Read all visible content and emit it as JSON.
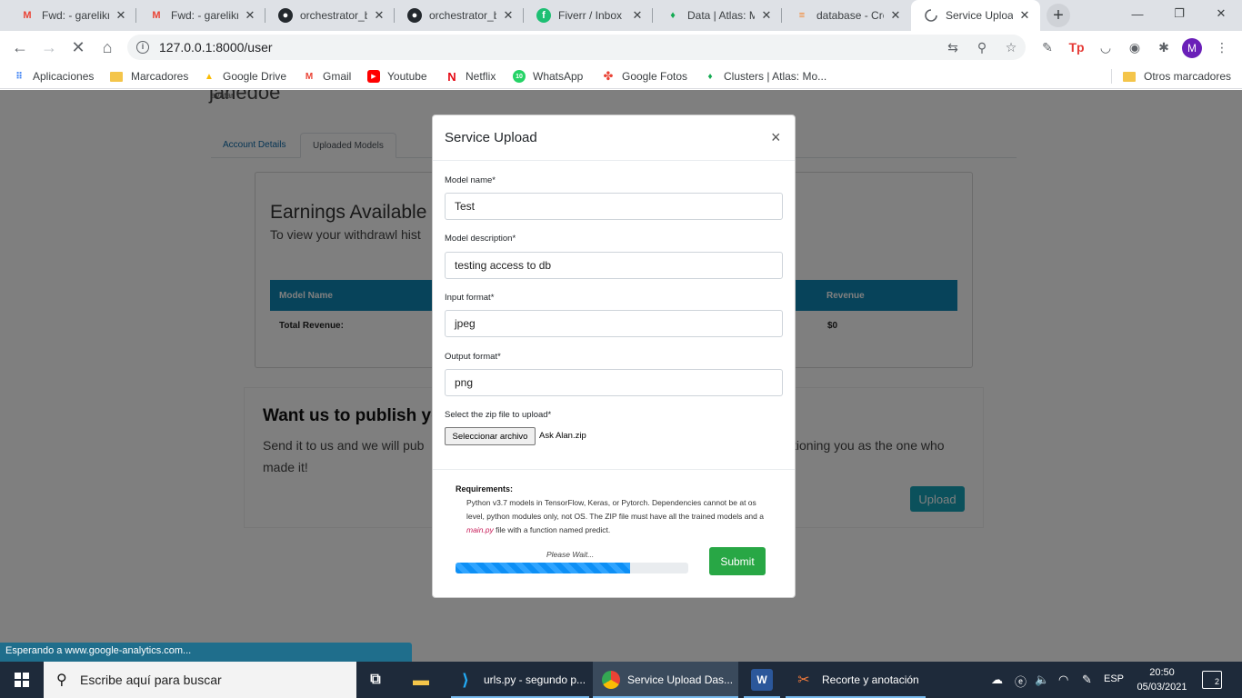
{
  "browser": {
    "tabs": [
      {
        "title": "Fwd: - garelikm",
        "icon": "gmail-icon",
        "active": false
      },
      {
        "title": "Fwd: - garelikm",
        "icon": "gmail-icon",
        "active": false
      },
      {
        "title": "orchestrator_b",
        "icon": "github-icon",
        "active": false
      },
      {
        "title": "orchestrator_b",
        "icon": "github-icon",
        "active": false
      },
      {
        "title": "Fiverr / Inbox",
        "icon": "fiverr-icon",
        "active": false
      },
      {
        "title": "Data | Atlas: M",
        "icon": "mongodb-icon",
        "active": false
      },
      {
        "title": "database - Cre",
        "icon": "stackoverflow-icon",
        "active": false
      },
      {
        "title": "Service Upload",
        "icon": "loading-icon",
        "active": true
      }
    ],
    "url": "127.0.0.1:8000/user",
    "profile_initial": "M",
    "bookmarks": [
      "Aplicaciones",
      "Marcadores",
      "Google Drive",
      "Gmail",
      "Youtube",
      "Netflix",
      "WhatsApp",
      "Google Fotos",
      "Clusters | Atlas: Mo...",
      "Otros marcadores"
    ],
    "status_text": "Esperando a www.google-analytics.com..."
  },
  "page": {
    "username": "janedoe",
    "avatar_alt": "avatar",
    "tabs": [
      "Account Details",
      "Uploaded Models"
    ],
    "earnings_title": "Earnings Available f",
    "earnings_sub": "To view your withdrawl hist",
    "table_headers": [
      "Model Name",
      "Revenue"
    ],
    "total_label": "Total Revenue:",
    "total_value": "$0",
    "publish_title": "Want us to publish yo",
    "publish_text_a": "Send it to us and we will pub",
    "publish_text_b": "tioning you as the one who",
    "publish_text_c": "made it!",
    "upload_button": "Upload"
  },
  "modal": {
    "title": "Service Upload",
    "close_glyph": "×",
    "fields": [
      {
        "label": "Model name*",
        "value": "Test"
      },
      {
        "label": "Model description*",
        "value": "testing access to db"
      },
      {
        "label": "Input format*",
        "value": "jpeg"
      },
      {
        "label": "Output format*",
        "value": "png"
      }
    ],
    "file_label": "Select the zip file to upload*",
    "file_button": "Seleccionar archivo",
    "file_name": "Ask Alan.zip",
    "requirements_title": "Requirements:",
    "requirements_a": "Python v3.7 models in TensorFlow, Keras, or Pytorch. Dependencies cannot be at os level, python modules only, not OS. The ZIP file must have all the trained models and a ",
    "requirements_file": "main.py",
    "requirements_b": " file with a function named predict.",
    "wait_text": "Please Wait...",
    "progress": 0.75,
    "submit": "Submit"
  },
  "taskbar": {
    "search_placeholder": "Escribe aquí para buscar",
    "items": [
      "urls.py - segundo p...",
      "Service Upload Das...",
      "Recorte y anotación"
    ],
    "language": "ESP",
    "time": "20:50",
    "date": "05/03/2021",
    "notifications": "2"
  }
}
